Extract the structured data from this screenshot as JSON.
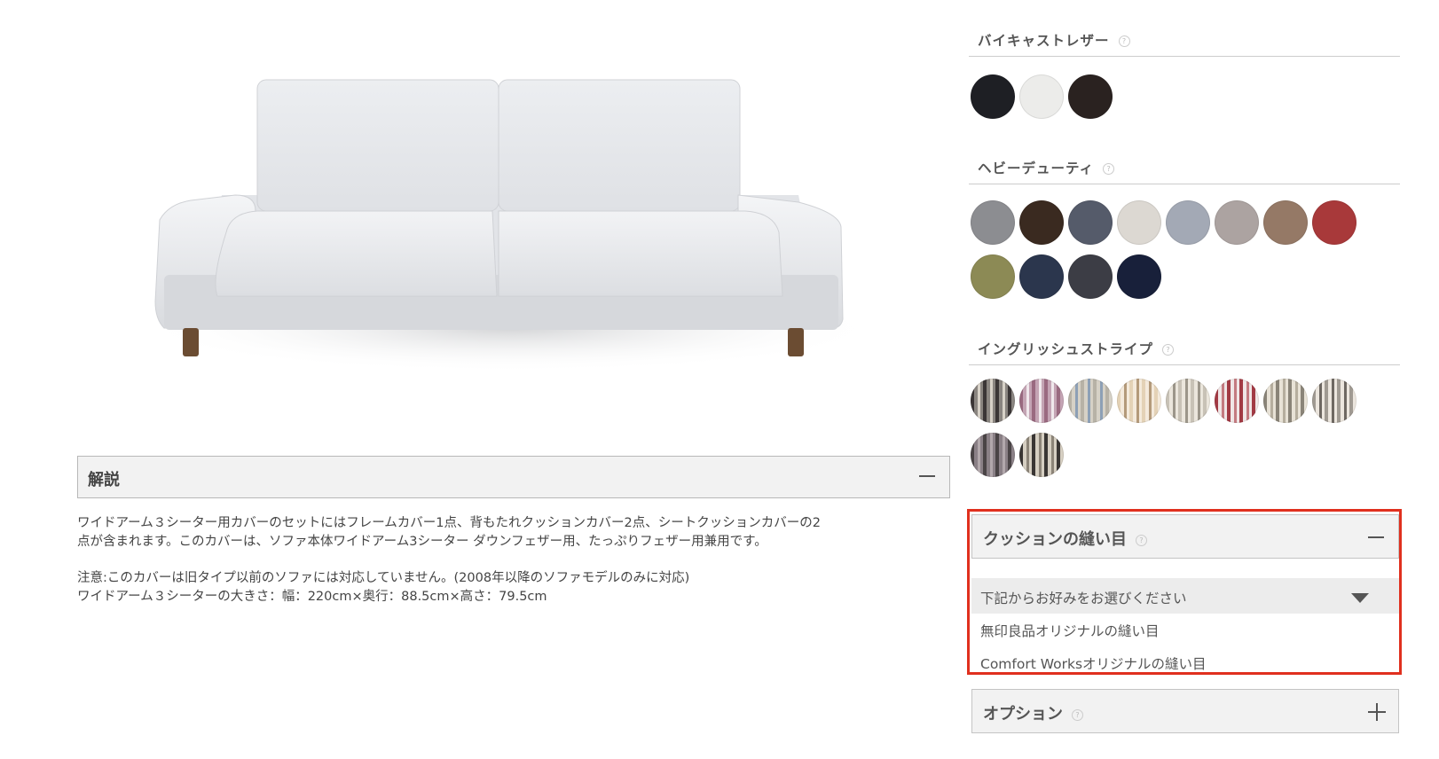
{
  "sofa_image": {
    "alt": ""
  },
  "description": {
    "title": "解説",
    "line1": "ワイドアーム３シーター用カバーのセットにはフレームカバー1点、背もたれクッションカバー2点、シートクッションカバーの2",
    "line2": "点が含まれます。このカバーは、ソファ本体ワイドアーム3シーター ダウンフェザー用、たっぷりフェザー用兼用です。",
    "line3": "注意:このカバーは旧タイプ以前のソファには対応していません。(2008年以降のソファモデルのみに対応)",
    "line4": "ワイドアーム３シーターの大きさ：幅：220cm×奥行：88.5cm×高さ：79.5cm"
  },
  "fabrics": {
    "bias_leather": {
      "title": "バイキャストレザー",
      "swatches": [
        {
          "name": "black-leather",
          "color": "#1e1f24"
        },
        {
          "name": "white-leather",
          "color": "#ececea"
        },
        {
          "name": "dark-brown-leather",
          "color": "#2a2220"
        }
      ]
    },
    "heavy_duty": {
      "title": "ヘビーデューティ",
      "swatches": [
        {
          "name": "grey",
          "color": "#8c8d91"
        },
        {
          "name": "chocolate",
          "color": "#3a2a20"
        },
        {
          "name": "slate",
          "color": "#555b6a"
        },
        {
          "name": "cream",
          "color": "#dcd8d2"
        },
        {
          "name": "silver-blue",
          "color": "#a3a9b5"
        },
        {
          "name": "taupe",
          "color": "#aca3a1"
        },
        {
          "name": "mocha",
          "color": "#957966"
        },
        {
          "name": "red",
          "color": "#a8393a"
        },
        {
          "name": "olive",
          "color": "#8c8a55"
        },
        {
          "name": "navy",
          "color": "#2b364d"
        },
        {
          "name": "charcoal",
          "color": "#3c3d45"
        },
        {
          "name": "midnight",
          "color": "#18203a"
        }
      ]
    },
    "english_stripe": {
      "title": "イングリッシュストライプ",
      "swatches": [
        {
          "name": "stripe-1",
          "c1": "#3b3636",
          "c2": "#8a8580",
          "c3": "#d8d2c8"
        },
        {
          "name": "stripe-2",
          "c1": "#9a6a80",
          "c2": "#c4a4b4",
          "c3": "#f0e8ec"
        },
        {
          "name": "stripe-3",
          "c1": "#b7b2a6",
          "c2": "#d6d1c6",
          "c3": "#8da0b6"
        },
        {
          "name": "stripe-4",
          "c1": "#e4d2b6",
          "c2": "#f4eadc",
          "c3": "#b49a7a"
        },
        {
          "name": "stripe-5",
          "c1": "#c8c2b6",
          "c2": "#ebe6dc",
          "c3": "#9c968a"
        },
        {
          "name": "stripe-6",
          "c1": "#a23a44",
          "c2": "#f0e6e6",
          "c3": "#c47a80"
        },
        {
          "name": "stripe-7",
          "c1": "#8a8478",
          "c2": "#e8e2d6",
          "c3": "#b6ae9e"
        },
        {
          "name": "stripe-8",
          "c1": "#a09a92",
          "c2": "#ece6de",
          "c3": "#6e6862"
        },
        {
          "name": "stripe-9",
          "c1": "#4a4446",
          "c2": "#8a8086",
          "c3": "#b2a8ac"
        },
        {
          "name": "stripe-10",
          "c1": "#3a3634",
          "c2": "#d6cfc2",
          "c3": "#8c8478"
        }
      ]
    }
  },
  "cushion_seam": {
    "title": "クッションの縫い目",
    "dropdown_label": "下記からお好みをお選びください",
    "options": [
      "無印良品オリジナルの縫い目",
      "Comfort Worksオリジナルの縫い目"
    ]
  },
  "options": {
    "title": "オプション"
  },
  "help_glyph": "?",
  "highlight_color": "#e0301e"
}
